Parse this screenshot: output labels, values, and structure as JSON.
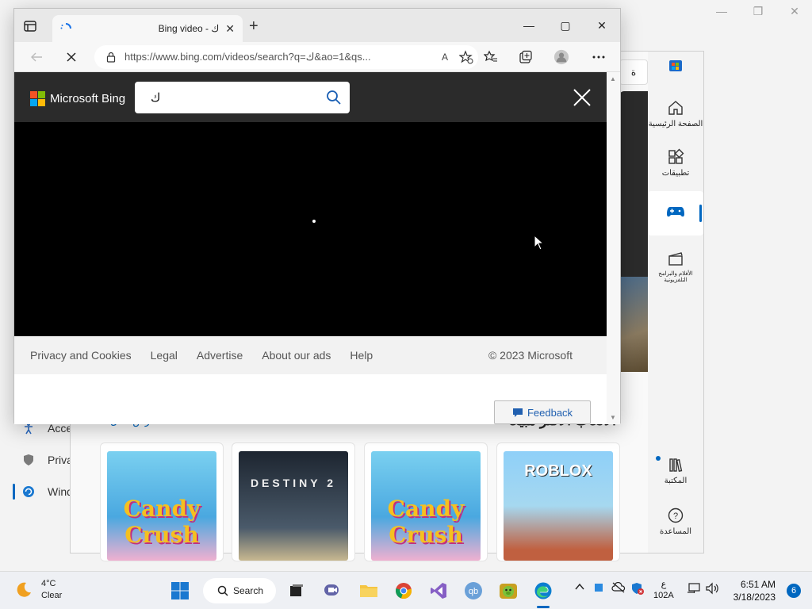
{
  "desktop": {
    "left_items": [
      {
        "label": "Acce",
        "icon": "accessibility-icon"
      },
      {
        "label": "Priva",
        "icon": "shield-icon"
      },
      {
        "label": "Wind",
        "icon": "windows-update-icon"
      }
    ]
  },
  "store": {
    "search_stub": "ة",
    "rail": [
      {
        "label": "الصفحة الرئيسية",
        "icon": "home-icon"
      },
      {
        "label": "تطبيقات",
        "icon": "apps-icon"
      },
      {
        "label": "",
        "icon": "gamepad-icon"
      },
      {
        "label": "الأفلام والبرامج التلفزيونية",
        "icon": "movies-icon"
      },
      {
        "label": "المكتبة",
        "icon": "library-icon"
      },
      {
        "label": "المساعدة",
        "icon": "help-icon"
      }
    ],
    "section_heading": "الألعاب الأكثر مبيعًا",
    "see_all": "عرض الكل",
    "tiles": [
      {
        "name": "Candy Crush Soda Saga",
        "logo": "Candy Crush"
      },
      {
        "name": "Destiny 2",
        "logo": "DESTINY 2"
      },
      {
        "name": "Candy Crush Saga",
        "logo": "Candy Crush"
      },
      {
        "name": "Roblox",
        "logo": "ROBLOX"
      }
    ]
  },
  "edge": {
    "tab_title": "Bing video - ك",
    "url": "https://www.bing.com/videos/search?q=ك&ao=1&qs...",
    "read_aloud": "A",
    "window_controls": {
      "minimize": "—",
      "maximize": "▢",
      "close": "✕"
    },
    "new_tab": "+"
  },
  "bing": {
    "brand": "Microsoft Bing",
    "query": "ك",
    "footer_links": [
      "Privacy and Cookies",
      "Legal",
      "Advertise",
      "About our ads",
      "Help"
    ],
    "copyright": "© 2023 Microsoft",
    "feedback": "Feedback"
  },
  "taskbar": {
    "weather_temp": "4°C",
    "weather_text": "Clear",
    "search_label": "Search",
    "lang_top": "ع",
    "lang_bottom": "102A",
    "time": "6:51 AM",
    "date": "3/18/2023",
    "notifications": "6"
  },
  "colors": {
    "accent": "#0067c0",
    "bing_header": "#2b2b2b",
    "video_bg": "#000000"
  }
}
